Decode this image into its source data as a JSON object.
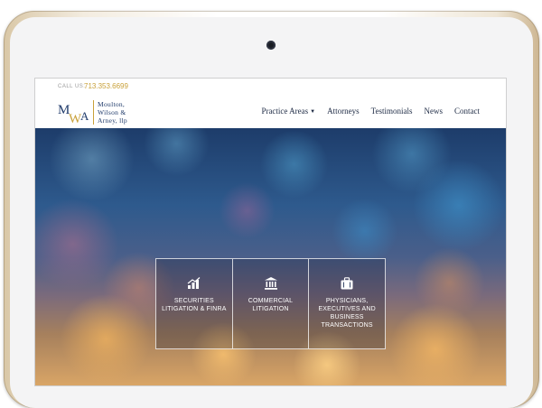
{
  "topbar": {
    "call_label": "CALL US:",
    "phone": "713.353.6699"
  },
  "logo": {
    "monogram": "MWA",
    "line1": "Moulton,",
    "line2": "Wilson &",
    "line3": "Arney, llp"
  },
  "nav": {
    "items": [
      {
        "label": "Practice Areas",
        "has_dropdown": true
      },
      {
        "label": "Attorneys"
      },
      {
        "label": "Testimonials"
      },
      {
        "label": "News"
      },
      {
        "label": "Contact"
      }
    ]
  },
  "hero": {
    "cards": [
      {
        "icon": "chart-icon",
        "label": "SECURITIES LITIGATION & FINRA"
      },
      {
        "icon": "courthouse-icon",
        "label": "COMMERCIAL LITIGATION"
      },
      {
        "icon": "briefcase-icon",
        "label": "PHYSICIANS, EXECUTIVES AND BUSINESS TRANSACTIONS"
      }
    ]
  },
  "colors": {
    "gold": "#c9a13a",
    "navy": "#1f3a6a",
    "text": "#1d2a44"
  }
}
